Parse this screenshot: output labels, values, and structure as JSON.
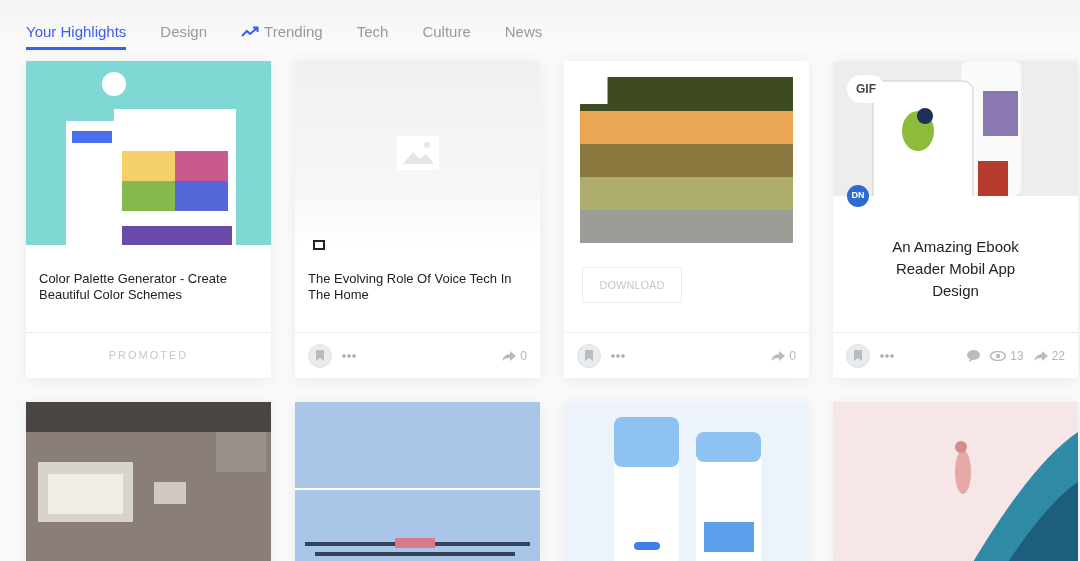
{
  "tabs": [
    {
      "label": "Your Highlights",
      "selected": true,
      "kind": "plain"
    },
    {
      "label": "Design",
      "selected": false,
      "kind": "plain"
    },
    {
      "label": "Trending",
      "selected": false,
      "kind": "trend"
    },
    {
      "label": "Tech",
      "selected": false,
      "kind": "plain"
    },
    {
      "label": "Culture",
      "selected": false,
      "kind": "plain"
    },
    {
      "label": "News",
      "selected": false,
      "kind": "plain"
    }
  ],
  "cards": [
    {
      "kind": "promoted",
      "title": "Color Palette Generator - Create Beautiful Color Schemes",
      "footer_label": "PROMOTED"
    },
    {
      "kind": "article",
      "title": "The Evolving Role Of Voice Tech In The Home",
      "shares": "0"
    },
    {
      "kind": "palette",
      "button": "DOWNLOAD",
      "shares": "0"
    },
    {
      "kind": "shot",
      "badge": "GIF",
      "avatar": "DN",
      "title": "An Amazing Ebook Reader Mobil App Design",
      "views": "13",
      "shares": "22"
    },
    {
      "kind": "picture"
    },
    {
      "kind": "picture"
    },
    {
      "kind": "picture"
    },
    {
      "kind": "picture"
    }
  ]
}
